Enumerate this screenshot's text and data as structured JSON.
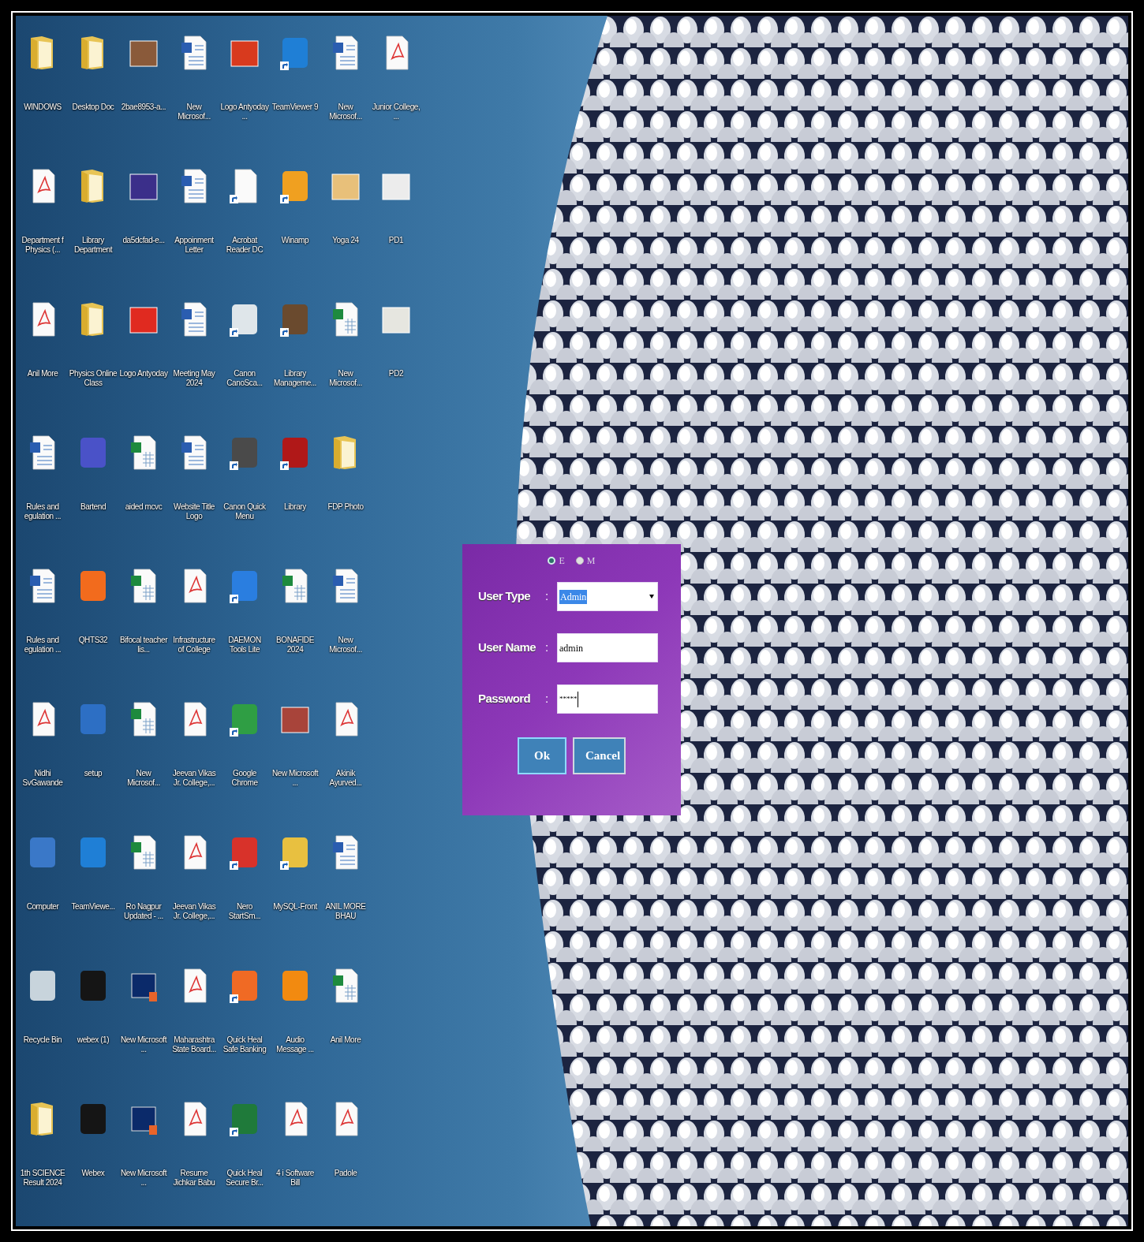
{
  "desktop_icons": [
    {
      "label": "WINDOWS",
      "kind": "folder",
      "shortcut": false
    },
    {
      "label": "Desktop Doc",
      "kind": "folder",
      "shortcut": false
    },
    {
      "label": "2bae8953-a...",
      "kind": "image",
      "color": "#8a5a3a",
      "shortcut": false
    },
    {
      "label": "New Microsof...",
      "kind": "word",
      "shortcut": false
    },
    {
      "label": "Logo Antyoday ...",
      "kind": "image",
      "color": "#d83a1e",
      "shortcut": false
    },
    {
      "label": "TeamViewer 9",
      "kind": "app",
      "color": "#1f7fd6",
      "shortcut": true
    },
    {
      "label": "New Microsof...",
      "kind": "word",
      "shortcut": false
    },
    {
      "label": "Junior College, ...",
      "kind": "pdf",
      "shortcut": false
    },
    {
      "label": "Department f Physics (...",
      "kind": "pdf",
      "shortcut": false
    },
    {
      "label": "Library Department",
      "kind": "folder",
      "shortcut": false
    },
    {
      "label": "da5dcfad-e...",
      "kind": "image",
      "color": "#3b2f8a",
      "shortcut": false
    },
    {
      "label": "Appoinment Letter",
      "kind": "word",
      "shortcut": false
    },
    {
      "label": "Acrobat Reader DC",
      "kind": "page",
      "shortcut": true
    },
    {
      "label": "Winamp",
      "kind": "app",
      "color": "#f0a020",
      "shortcut": true
    },
    {
      "label": "Yoga 24",
      "kind": "image",
      "color": "#e8c07a",
      "shortcut": false
    },
    {
      "label": "PD1",
      "kind": "image",
      "color": "#ececec",
      "shortcut": false
    },
    {
      "label": "Anil More",
      "kind": "pdf",
      "shortcut": false
    },
    {
      "label": "Physics Online Class",
      "kind": "folder",
      "shortcut": false
    },
    {
      "label": "Logo Antyoday",
      "kind": "image",
      "color": "#e02a20",
      "shortcut": false
    },
    {
      "label": "Meeting May 2024",
      "kind": "word",
      "shortcut": false
    },
    {
      "label": "Canon CanoSca...",
      "kind": "app",
      "color": "#dfe6ea",
      "shortcut": true
    },
    {
      "label": "Library Manageme...",
      "kind": "app",
      "color": "#6a4a2e",
      "shortcut": true
    },
    {
      "label": "New Microsof...",
      "kind": "excel",
      "shortcut": false
    },
    {
      "label": "PD2",
      "kind": "image",
      "color": "#e6e6e0",
      "shortcut": false
    },
    {
      "label": "Rules and egulation ...",
      "kind": "word",
      "shortcut": false
    },
    {
      "label": "Bartend",
      "kind": "app",
      "color": "#4a52c8",
      "shortcut": false
    },
    {
      "label": "aided mcvc",
      "kind": "excel",
      "shortcut": false
    },
    {
      "label": "Website Title Logo",
      "kind": "word",
      "shortcut": false
    },
    {
      "label": "Canon Quick Menu",
      "kind": "app",
      "color": "#4a4a4a",
      "shortcut": true
    },
    {
      "label": "Library",
      "kind": "app",
      "color": "#b01818",
      "shortcut": true
    },
    {
      "label": "FDP Photo",
      "kind": "folder",
      "shortcut": false
    },
    {
      "label": "Rules and egulation ...",
      "kind": "word",
      "shortcut": false
    },
    {
      "label": "QHTS32",
      "kind": "app",
      "color": "#f26b1d",
      "shortcut": false
    },
    {
      "label": "Bifocal teacher lis...",
      "kind": "excel",
      "shortcut": false
    },
    {
      "label": "Infrastructure of College",
      "kind": "pdf",
      "shortcut": false
    },
    {
      "label": "DAEMON Tools Lite",
      "kind": "app",
      "color": "#2a7ee0",
      "shortcut": true
    },
    {
      "label": "BONAFIDE 2024",
      "kind": "excel",
      "shortcut": false
    },
    {
      "label": "New Microsof...",
      "kind": "word",
      "shortcut": false
    },
    {
      "label": "Nidhi SvGawande",
      "kind": "pdf",
      "shortcut": false
    },
    {
      "label": "setup",
      "kind": "app",
      "color": "#2d6fc4",
      "shortcut": false
    },
    {
      "label": "New Microsof...",
      "kind": "excel",
      "shortcut": false
    },
    {
      "label": "Jeevan Vikas Jr. College,...",
      "kind": "pdf",
      "shortcut": false
    },
    {
      "label": "Google Chrome",
      "kind": "app",
      "color": "#2f9e44",
      "shortcut": true
    },
    {
      "label": "New Microsoft ...",
      "kind": "image",
      "color": "#a8443a",
      "shortcut": false
    },
    {
      "label": "Akinik Ayurved...",
      "kind": "pdf",
      "shortcut": false
    },
    {
      "label": "Computer",
      "kind": "app",
      "color": "#3a78c8",
      "shortcut": false
    },
    {
      "label": "TeamViewe...",
      "kind": "app",
      "color": "#1f7fd6",
      "shortcut": false
    },
    {
      "label": "Ro Nagpur Updated - ...",
      "kind": "excel",
      "shortcut": false
    },
    {
      "label": "Jeevan Vikas Jr. College,...",
      "kind": "pdf",
      "shortcut": false
    },
    {
      "label": "Nero StartSm...",
      "kind": "app",
      "color": "#d8322a",
      "shortcut": true
    },
    {
      "label": "MySQL-Front",
      "kind": "app",
      "color": "#e8c040",
      "shortcut": true
    },
    {
      "label": "ANIL MORE BHAU",
      "kind": "word",
      "shortcut": false
    },
    {
      "label": "Recycle Bin",
      "kind": "app",
      "color": "#c8d4dc",
      "shortcut": false
    },
    {
      "label": "webex (1)",
      "kind": "app",
      "color": "#151515",
      "shortcut": false
    },
    {
      "label": "New Microsoft ...",
      "kind": "ppt",
      "shortcut": false
    },
    {
      "label": "Maharashtra State Board...",
      "kind": "pdf",
      "shortcut": false
    },
    {
      "label": "Quick Heal Safe Banking",
      "kind": "app",
      "color": "#f06a24",
      "shortcut": true
    },
    {
      "label": "Audio Message ...",
      "kind": "app",
      "color": "#f28a10",
      "shortcut": false
    },
    {
      "label": "Anil More",
      "kind": "excel",
      "shortcut": false
    },
    {
      "label": "1th SCIENCE Result 2024",
      "kind": "folder",
      "shortcut": false
    },
    {
      "label": "Webex",
      "kind": "app",
      "color": "#151515",
      "shortcut": false
    },
    {
      "label": "New Microsoft ...",
      "kind": "ppt",
      "shortcut": false
    },
    {
      "label": "Resume Jichkar Babu",
      "kind": "pdf",
      "shortcut": false
    },
    {
      "label": "Quick Heal Secure Br...",
      "kind": "app",
      "color": "#1f7a3a",
      "shortcut": true
    },
    {
      "label": "4 i Software Bill",
      "kind": "pdf",
      "shortcut": false
    },
    {
      "label": "Padole",
      "kind": "pdf",
      "shortcut": false
    }
  ],
  "login_dialog": {
    "language_options": [
      {
        "label": "E",
        "selected": true
      },
      {
        "label": "M",
        "selected": false
      }
    ],
    "fields": [
      {
        "label": "User Type",
        "separator": ":",
        "kind": "select",
        "value": "Admin"
      },
      {
        "label": "User Name",
        "separator": ":",
        "kind": "text",
        "value": "admin"
      },
      {
        "label": "Password",
        "separator": ":",
        "kind": "password",
        "value": "*****"
      }
    ],
    "buttons": [
      {
        "label": "Ok",
        "focused": true
      },
      {
        "label": "Cancel",
        "focused": false
      }
    ]
  }
}
